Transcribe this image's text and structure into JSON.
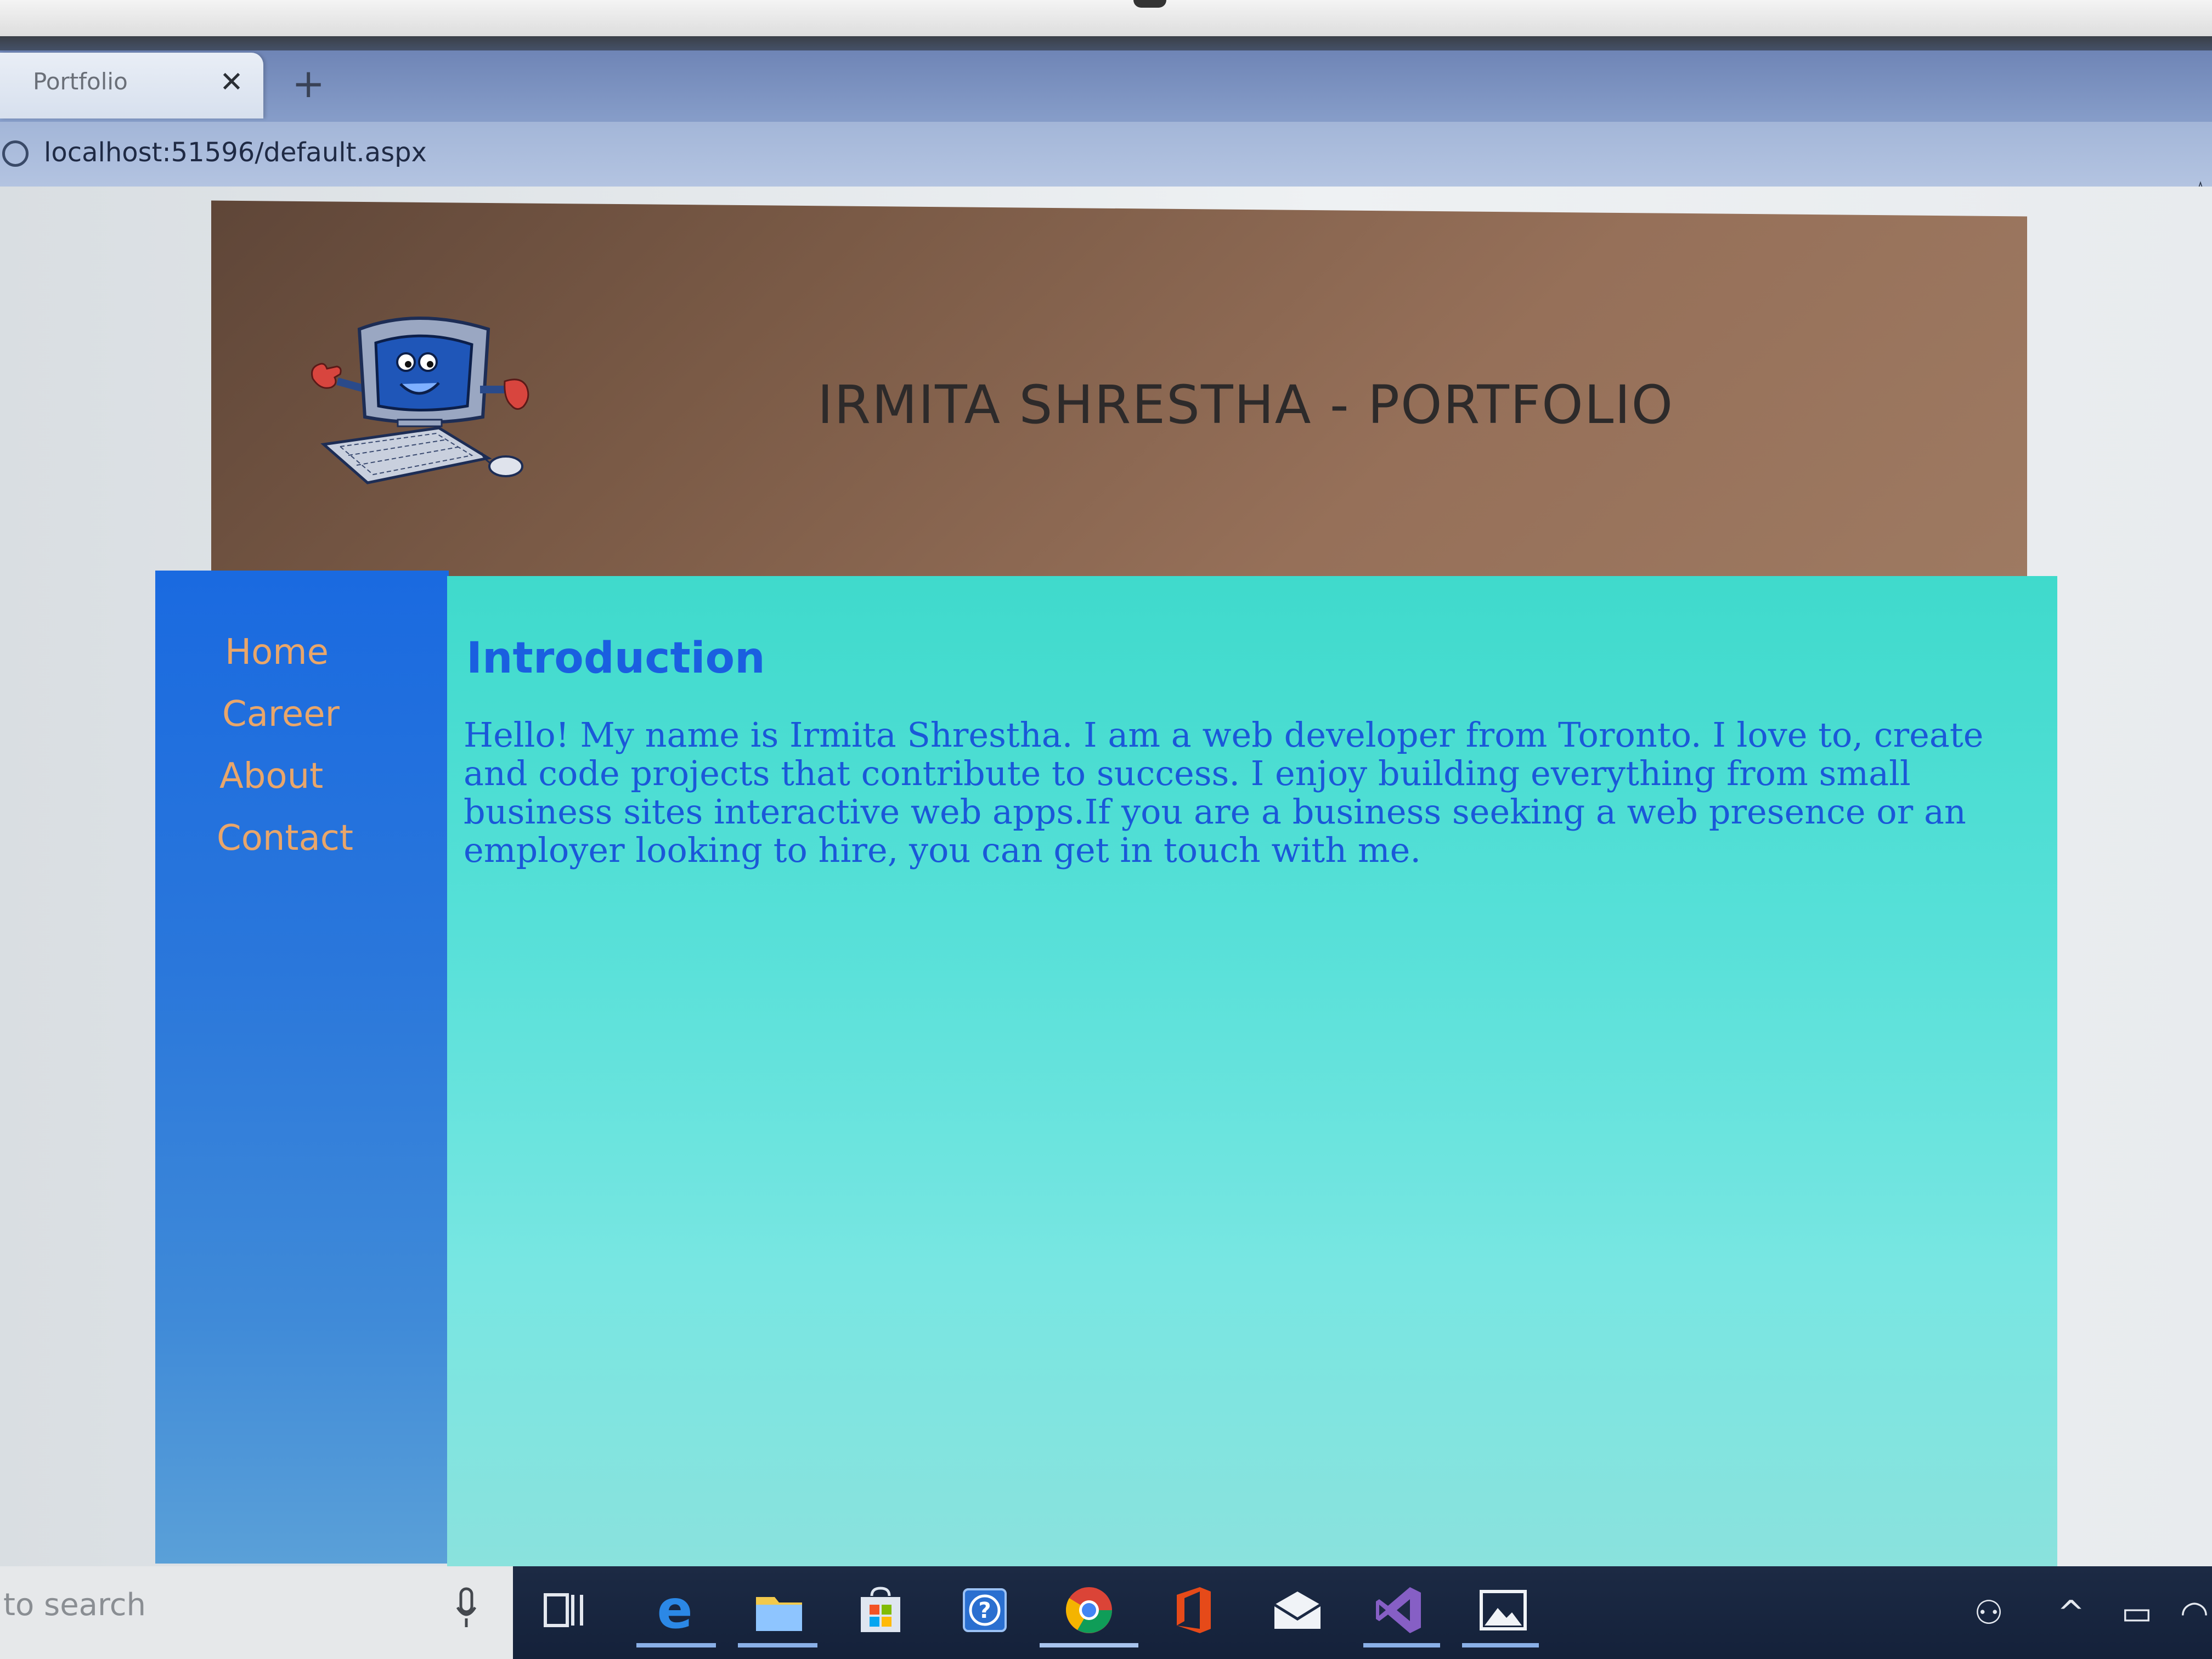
{
  "browser": {
    "tab_title": "Portfolio",
    "tab_close": "✕",
    "new_tab": "+",
    "url": "localhost:51596/default.aspx"
  },
  "site": {
    "title": "IRMITA SHRESTHA - PORTFOLIO",
    "nav": [
      {
        "label": "Home"
      },
      {
        "label": "Career"
      },
      {
        "label": "About"
      },
      {
        "label": "Contact"
      }
    ],
    "content": {
      "heading": "Introduction",
      "body": "Hello! My name is Irmita Shrestha. I am a web developer from Toronto. I love to, create and code projects that contribute to success. I enjoy building everything from small business sites interactive web apps.If you are a business seeking a web presence or an employer looking to hire, you can get in touch with me."
    }
  },
  "taskbar": {
    "search_placeholder": "to search",
    "apps": [
      {
        "name": "task-view-icon"
      },
      {
        "name": "edge-icon"
      },
      {
        "name": "file-explorer-icon"
      },
      {
        "name": "store-icon"
      },
      {
        "name": "help-icon"
      },
      {
        "name": "chrome-icon"
      },
      {
        "name": "office-icon"
      },
      {
        "name": "mail-icon"
      },
      {
        "name": "visual-studio-icon"
      },
      {
        "name": "photos-icon"
      }
    ]
  },
  "colors": {
    "header_bg": "#8a6550",
    "sidebar_bg": "#2a77db",
    "content_bg": "#56e0d8",
    "nav_link": "#e9a66a",
    "heading": "#1a5fe0",
    "body_text": "#1a58d8"
  }
}
